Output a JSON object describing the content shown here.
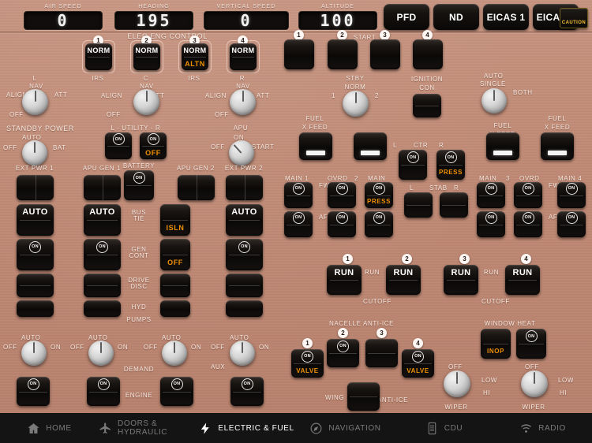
{
  "header": {
    "readouts": [
      {
        "label": "AIR SPEED",
        "value": "0"
      },
      {
        "label": "HEADING",
        "value": "195"
      },
      {
        "label": "VERTICAL SPEED",
        "value": "0"
      },
      {
        "label": "ALTITUDE",
        "value": "100"
      }
    ],
    "display_buttons": [
      "PFD",
      "ND",
      "EICAS 1",
      "EICAS 2"
    ],
    "caution_label": "CAUTION"
  },
  "elec_eng_control": {
    "title": "ELEC ENG CONTROL",
    "switches": [
      {
        "num": "1",
        "top": "NORM",
        "bottom": ""
      },
      {
        "num": "2",
        "top": "NORM",
        "bottom": ""
      },
      {
        "num": "3",
        "top": "NORM",
        "bottom": "ALTN"
      },
      {
        "num": "4",
        "top": "NORM",
        "bottom": ""
      }
    ]
  },
  "irs": {
    "label_left": "IRS",
    "label_right": "IRS",
    "knobs": [
      {
        "name": "L",
        "align": "ALIGN",
        "nav": "NAV",
        "att": "ATT",
        "off": "OFF"
      },
      {
        "name": "C",
        "align": "ALIGN",
        "nav": "NAV",
        "att": "ATT",
        "off": "OFF"
      },
      {
        "name": "R",
        "align": "ALIGN",
        "nav": "NAV",
        "att": "ATT",
        "off": "OFF"
      }
    ]
  },
  "standby_power": {
    "title": "STANDBY POWER",
    "off": "OFF",
    "auto": "AUTO",
    "bat": "BAT"
  },
  "utility": {
    "title": "L - UTILITY - R",
    "left": {
      "state": "ON",
      "alt": ""
    },
    "right": {
      "state": "ON",
      "alt": "OFF"
    }
  },
  "battery": {
    "title": "BATTERY",
    "state": "ON"
  },
  "apu": {
    "title": "APU",
    "off": "OFF",
    "on": "ON",
    "start": "START"
  },
  "electrical": {
    "columns": [
      "EXT PWR 1",
      "APU GEN 1",
      "APU GEN 2",
      "EXT PWR 2"
    ],
    "rows": [
      "BUS TIE",
      "GEN CONT",
      "DRIVE DISC",
      "HYD",
      "PUMPS"
    ],
    "auto_label": "AUTO",
    "on_label": "ON",
    "isln_label": "ISLN",
    "off_label": "OFF"
  },
  "hyd": {
    "demand": "DEMAND",
    "engine": "ENGINE",
    "knobs": [
      {
        "off": "OFF",
        "auto": "AUTO",
        "on": "ON",
        "aux": ""
      },
      {
        "off": "OFF",
        "auto": "AUTO",
        "on": "ON",
        "aux": ""
      },
      {
        "off": "OFF",
        "auto": "AUTO",
        "on": "ON",
        "aux": ""
      },
      {
        "off": "OFF",
        "auto": "AUTO",
        "on": "ON",
        "aux": "AUX"
      }
    ],
    "engine_state": "ON"
  },
  "start": {
    "title": "START",
    "buttons": [
      "1",
      "2",
      "3",
      "4"
    ],
    "stby": "STBY",
    "norm": "NORM",
    "pos1": "1",
    "pos2": "2"
  },
  "ignition": {
    "title": "IGNITION\nCON",
    "line1": "IGNITION",
    "line2": "CON"
  },
  "fuel_auto": {
    "auto": "AUTO",
    "single": "SINGLE",
    "both": "BOTH"
  },
  "fuel_xfeed": {
    "label_left": "FUEL\nX FEED",
    "line1": "FUEL",
    "line2": "X FEED"
  },
  "fuel_pumps": {
    "main1": "MAIN 1",
    "ovrd2_a": "OVRD",
    "ovrd2_b": "2",
    "main2": "MAIN",
    "main3": "MAIN",
    "num3": "3",
    "ovrd4": "OVRD",
    "main4": "MAIN 4",
    "fwd": "FWD",
    "aft": "AFT",
    "press": "PRESS",
    "on": "ON",
    "ctr": {
      "l": "L",
      "c": "CTR",
      "r": "R"
    },
    "stab": {
      "l": "L",
      "c": "STAB",
      "r": "R"
    }
  },
  "engine_fuel": {
    "buttons": [
      {
        "num": "1",
        "label": "RUN"
      },
      {
        "num": "2",
        "label": "RUN"
      },
      {
        "num": "3",
        "label": "RUN"
      },
      {
        "num": "4",
        "label": "RUN"
      }
    ],
    "run": "RUN",
    "cutoff": "CUTOFF"
  },
  "anti_ice": {
    "title": "NACELLE ANTI-ICE",
    "nacelles": [
      {
        "num": "1",
        "state": "ON",
        "valve": "VALVE"
      },
      {
        "num": "2",
        "state": "ON",
        "valve": ""
      },
      {
        "num": "3",
        "state": "",
        "valve": ""
      },
      {
        "num": "4",
        "state": "ON",
        "valve": "VALVE"
      }
    ],
    "wing": "WING",
    "wing_suffix": "ANTI-ICE"
  },
  "window_heat": {
    "title": "WINDOW HEAT",
    "left_state": "INOP",
    "right_state": "ON"
  },
  "wiper": {
    "title": "WIPER",
    "off": "OFF",
    "low": "LOW",
    "hi": "HI"
  },
  "tabs": [
    {
      "label": "HOME",
      "icon": "home-icon",
      "active": false
    },
    {
      "label": "DOORS & HYDRAULIC",
      "icon": "plane-icon",
      "active": false
    },
    {
      "label": "ELECTRIC & FUEL",
      "icon": "bolt-icon",
      "active": true
    },
    {
      "label": "NAVIGATION",
      "icon": "compass-icon",
      "active": false
    },
    {
      "label": "CDU",
      "icon": "keypad-icon",
      "active": false
    },
    {
      "label": "RADIO",
      "icon": "wifi-icon",
      "active": false
    }
  ],
  "colors": {
    "panel": "#c08a75",
    "amber": "#f09000",
    "white": "#ffffff",
    "caution": "#f5c033"
  }
}
